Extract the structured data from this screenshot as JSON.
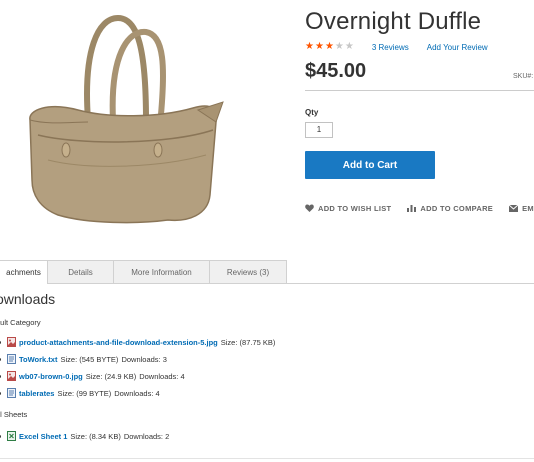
{
  "product": {
    "title": "Overnight Duffle",
    "rating": 3,
    "rating_max": 5,
    "reviews_link": "3  Reviews",
    "add_review": "Add Your Review",
    "price": "$45.00",
    "sku_label": "SKU#:",
    "qty_label": "Qty",
    "qty_value": "1",
    "add_to_cart": "Add to Cart",
    "actions": {
      "wish_list": "ADD TO WISH LIST",
      "compare": "ADD TO COMPARE",
      "email": "EMAI"
    }
  },
  "tabs": [
    {
      "label": "achments",
      "active": true
    },
    {
      "label": "Details",
      "active": false
    },
    {
      "label": "More Information",
      "active": false
    },
    {
      "label": "Reviews (3)",
      "active": false
    }
  ],
  "downloads": {
    "title": "ownloads",
    "groups": [
      {
        "title": "ault Category",
        "files": [
          {
            "name": "product-attachments-and-file-download-extension-5.jpg",
            "size": "Size: (87.75 KB)",
            "downloads": "",
            "icon": "image-file-icon"
          },
          {
            "name": "ToWork.txt",
            "size": "Size: (545 BYTE)",
            "downloads": "Downloads: 3",
            "icon": "text-file-icon"
          },
          {
            "name": "wb07-brown-0.jpg",
            "size": "Size: (24.9 KB)",
            "downloads": "Downloads: 4",
            "icon": "image-file-icon"
          },
          {
            "name": "tablerates",
            "size": "Size: (99 BYTE)",
            "downloads": "Downloads: 4",
            "icon": "text-file-icon"
          }
        ]
      },
      {
        "title": "el Sheets",
        "files": [
          {
            "name": "Excel Sheet 1",
            "size": "Size: (8.34 KB)",
            "downloads": "Downloads: 2",
            "icon": "excel-file-icon"
          }
        ]
      }
    ]
  },
  "colors": {
    "accent": "#1979c3",
    "link": "#006bb4",
    "star": "#ff5501"
  }
}
